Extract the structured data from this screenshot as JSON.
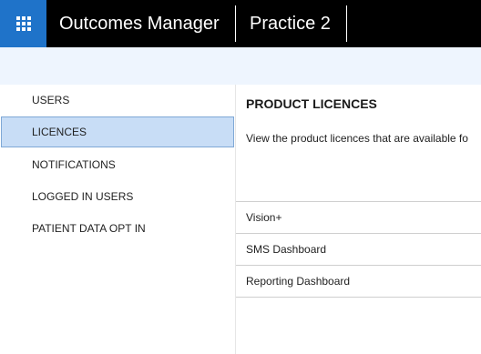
{
  "header": {
    "app_title": "Outcomes Manager",
    "practice_name": "Practice 2",
    "launcher_icon": "waffle-grid-icon",
    "colors": {
      "bar": "#000000",
      "launcher": "#1f73c9"
    }
  },
  "sidebar": {
    "active_index": 1,
    "items": [
      {
        "label": "USERS"
      },
      {
        "label": "LICENCES"
      },
      {
        "label": "NOTIFICATIONS"
      },
      {
        "label": "LOGGED IN USERS"
      },
      {
        "label": "PATIENT DATA OPT IN"
      }
    ],
    "colors": {
      "active_bg": "#c8ddf6",
      "active_border": "#7fa8d6"
    }
  },
  "main": {
    "heading": "PRODUCT LICENCES",
    "description": "View the product licences that are available fo",
    "licences": [
      {
        "name": "Vision+"
      },
      {
        "name": "SMS Dashboard"
      },
      {
        "name": "Reporting Dashboard"
      }
    ]
  }
}
